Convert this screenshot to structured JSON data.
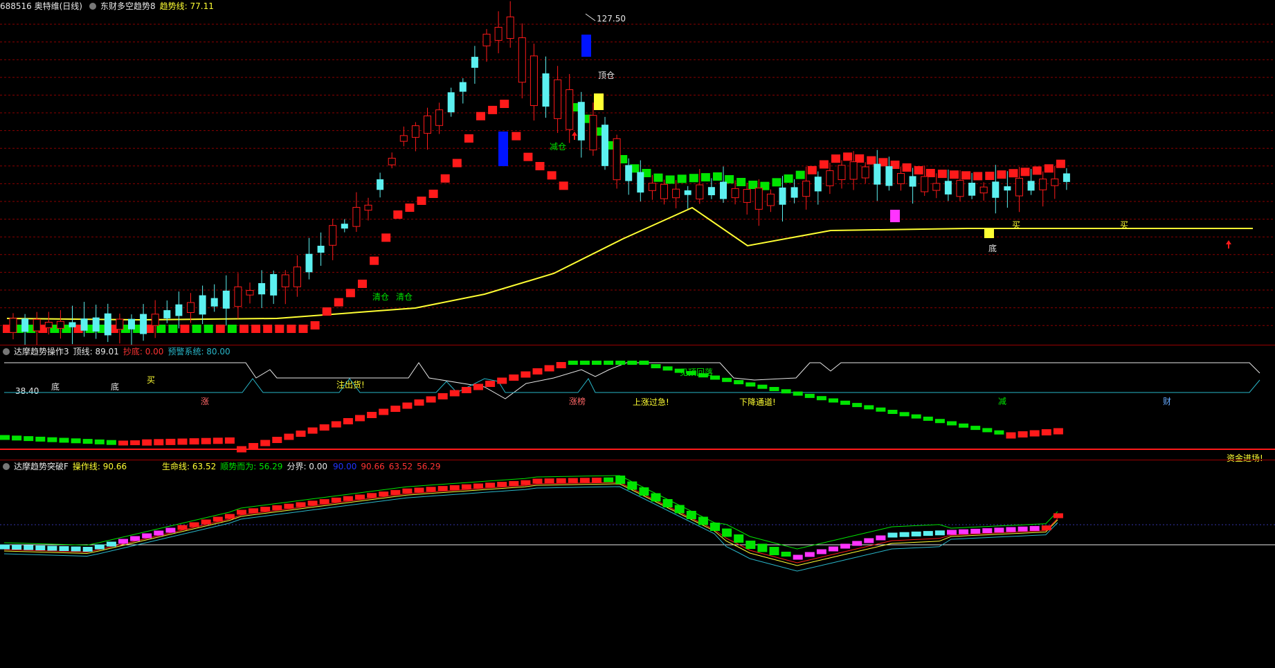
{
  "colors": {
    "up": "#ff1a1a",
    "down": "#5cf0f0",
    "green": "#00e400",
    "yellow": "#ffff33",
    "blue": "#0014ff",
    "magenta": "#ff33ff",
    "grid": "#8b0000",
    "white": "#e8e8e8",
    "cyan_line": "#29b6c9",
    "bg": "#000000"
  },
  "main": {
    "symbol": "688516 奥特维(日线)",
    "indicator": "东财多空趋势8",
    "trend_label": "趋势线: 77.11",
    "high_label": "127.50",
    "low_label": "38.40",
    "buy_labels": [
      "买",
      "买",
      "买",
      "买"
    ],
    "bottom_labels": [
      "底",
      "底",
      "底"
    ],
    "clear_labels": [
      "清仓",
      "清仓",
      "减仓",
      "顶仓"
    ],
    "events": [
      "涨",
      "涨榜",
      "减",
      "财"
    ]
  },
  "panel2": {
    "title": "达摩趋势操作3",
    "top_line": "顶线: 89.01",
    "bottom_buy": "抄底: 0.00",
    "warning": "预警系统: 80.00",
    "annotations": [
      "注出货!",
      "见顶回落",
      "上涨过急!",
      "下降通道!",
      "资金进场!"
    ]
  },
  "panel3": {
    "title": "达摩趋势突破F",
    "op_line": "操作线: 90.66",
    "life_line": "生命线: 63.52",
    "trend_up": "顺势而为: 56.29",
    "boundary": "分界: 0.00",
    "values": [
      "90.00",
      "90.66",
      "63.52",
      "56.29"
    ]
  }
}
